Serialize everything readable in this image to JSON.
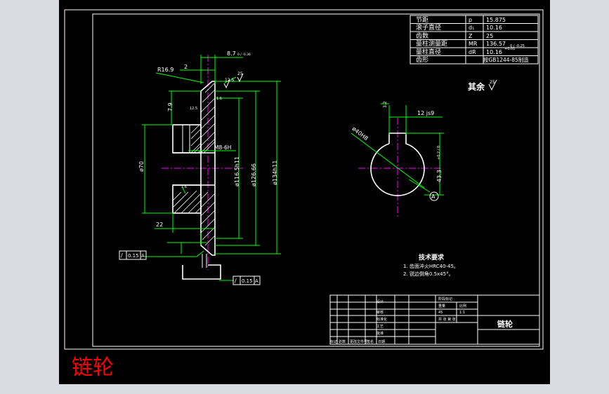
{
  "window": {
    "background": "#000000",
    "frame_color": "#ffffff",
    "dim_color": "#00ff00",
    "center_color": "#ff00ff",
    "title_color": "#ff0000"
  },
  "params_table": {
    "rows": [
      {
        "label": "节距",
        "symbol": "p",
        "value": "15.875"
      },
      {
        "label": "滚子直径",
        "symbol": "d₁",
        "value": "10.16"
      },
      {
        "label": "齿数",
        "symbol": "Z",
        "value": "25"
      },
      {
        "label": "量柱测量距",
        "symbol": "MR",
        "value": "136.57",
        "tol": "0 / -0.25"
      },
      {
        "label": "量柱直径",
        "symbol": "dR",
        "value": "10.16",
        "tol": "+0.01"
      },
      {
        "label": "齿形",
        "symbol": "",
        "value": "按GB1244-85制造"
      }
    ]
  },
  "surface_note": {
    "text": "其余",
    "roughness": "25"
  },
  "dimensions": {
    "face_width": "8.7",
    "face_width_tol": "0 / -0.36",
    "radius": "R16.9",
    "chamfer": "2",
    "roughness_top": "25",
    "roughness_mid": "12.5",
    "roughness_bore": "12.5",
    "roughness_hub": "1.6",
    "roughness_inner": "1.6",
    "hub_height": "7.9",
    "thread": "M8-6H",
    "hub_dia": "ø70",
    "dia_1": "ø116.5h11",
    "dia_2": "ø126.66",
    "dia_3": "ø134h11",
    "hub_len": "22",
    "roughness_lower": "1.6",
    "keyway_width": "12 js9",
    "keyway_rough": "3.2",
    "bore_dia": "ø40H8",
    "keyway_depth": "43.3",
    "keyway_depth_tol": "+0.2 / 0",
    "datum": "A"
  },
  "tolerance_frames": [
    {
      "symbol": "/",
      "value": "0.15",
      "datum": "A"
    },
    {
      "symbol": "/",
      "value": "0.15",
      "datum": "A"
    }
  ],
  "tech_requirements": {
    "title": "技术要求",
    "items": [
      "1. 齿面淬火HRC40-45。",
      "2. 锐边倒角0.5x45°。"
    ]
  },
  "title_block": {
    "part_name": "链轮",
    "labels": {
      "design": "设计",
      "check": "审核",
      "standard": "标准化",
      "approve": "批准",
      "process": "工艺",
      "date": "日期",
      "marking": "标记",
      "sections": "处数",
      "revision": "更改文件号",
      "signature": "签名",
      "stage_mark": "阶段标记",
      "weight": "重量",
      "scale": "比例",
      "material": "45",
      "scale_value": "1:1",
      "sheet": "共 张 第 张"
    }
  },
  "big_title": "链轮"
}
